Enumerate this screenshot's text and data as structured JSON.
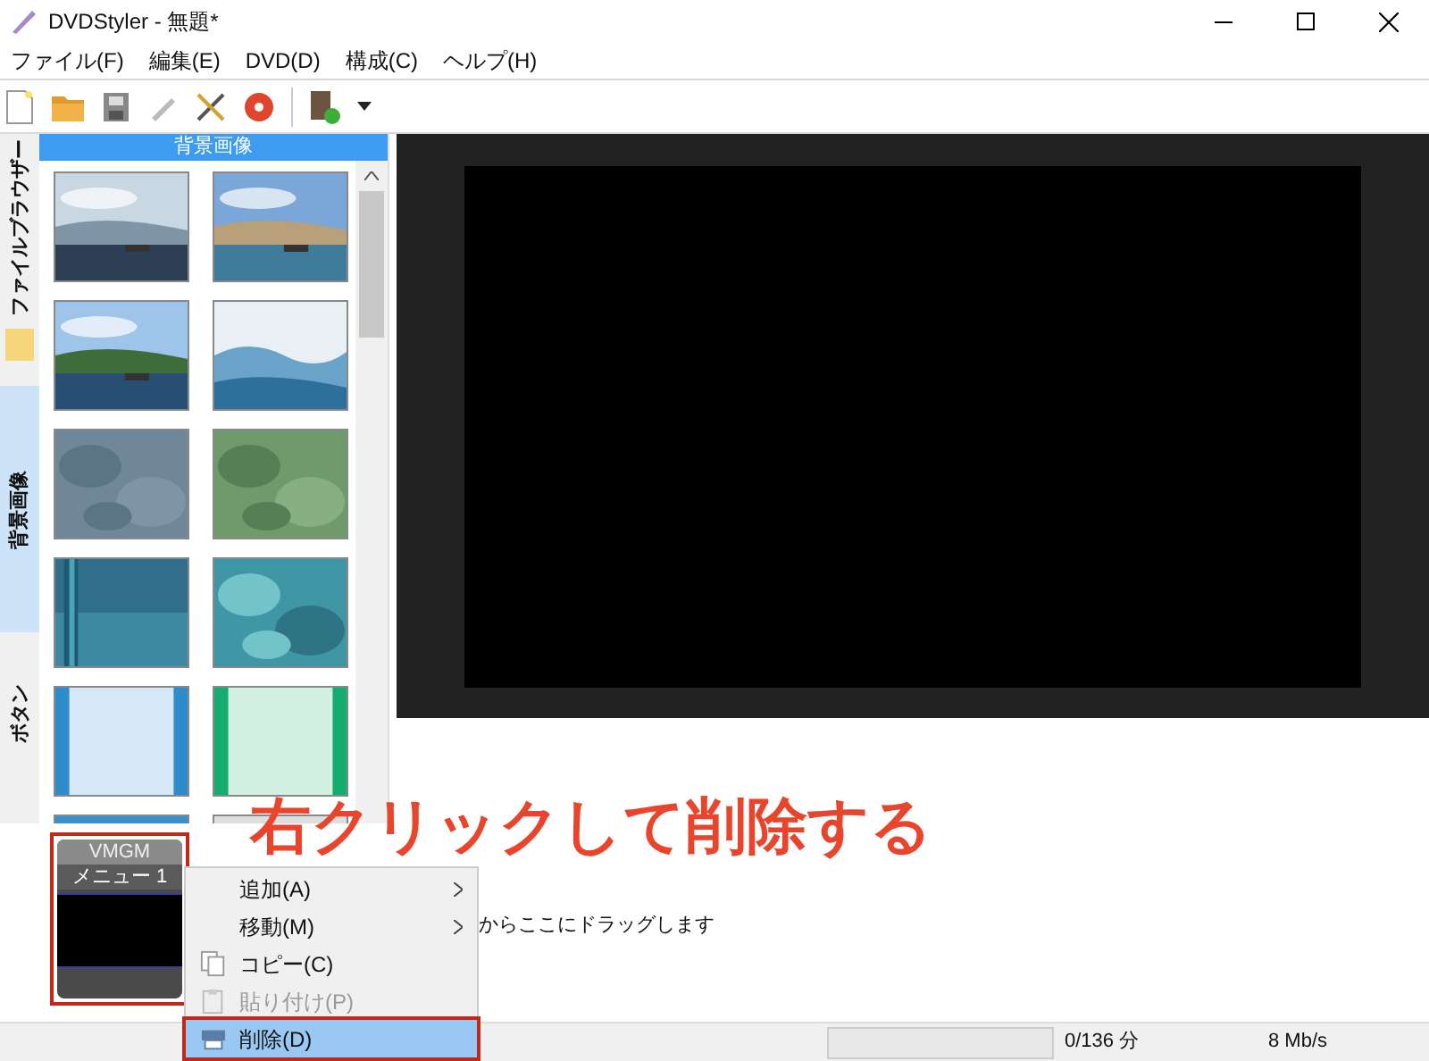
{
  "window": {
    "title": "DVDStyler - 無題*"
  },
  "menu_bar": [
    "ファイル(F)",
    "編集(E)",
    "DVD(D)",
    "構成(C)",
    "ヘルプ(H)"
  ],
  "side_tabs": [
    {
      "label": "ファイルブラウザー",
      "selected": false
    },
    {
      "label": "背景画像",
      "selected": true
    },
    {
      "label": "ボタン",
      "selected": false
    }
  ],
  "panel": {
    "title": "背景画像"
  },
  "titleset": {
    "menu": {
      "header": "VMGM",
      "title": "メニュー 1",
      "highlighted": true
    },
    "hint": "からここにドラッグします"
  },
  "annotation": {
    "text": "右クリックして削除する"
  },
  "context_menu": [
    {
      "kind": "submenu",
      "label": "追加(A)",
      "disabled": false,
      "selected": false,
      "highlighted": false
    },
    {
      "kind": "submenu",
      "label": "移動(M)",
      "disabled": false,
      "selected": false,
      "highlighted": false
    },
    {
      "kind": "copy",
      "label": "コピー(C)",
      "disabled": false,
      "selected": false,
      "highlighted": false
    },
    {
      "kind": "paste",
      "label": "貼り付け(P)",
      "disabled": true,
      "selected": false,
      "highlighted": false
    },
    {
      "kind": "delete",
      "label": "削除(D)",
      "disabled": false,
      "selected": true,
      "highlighted": true
    }
  ],
  "status_bar": {
    "duration": "0/136 分",
    "bitrate": "8 Mb/s"
  }
}
